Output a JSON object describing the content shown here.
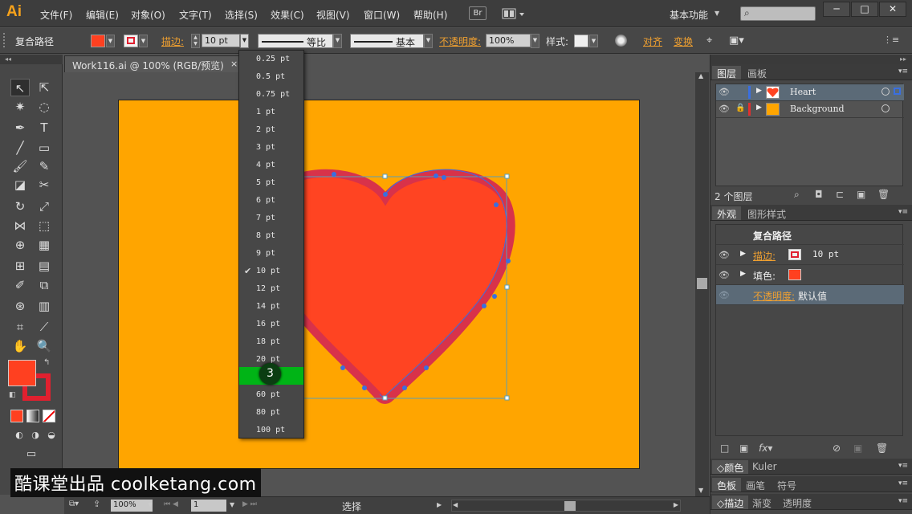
{
  "app": {
    "logo": "Ai",
    "workspace": "基本功能",
    "bridge_label": "Br"
  },
  "menu": [
    "文件(F)",
    "编辑(E)",
    "对象(O)",
    "文字(T)",
    "选择(S)",
    "效果(C)",
    "视图(V)",
    "窗口(W)",
    "帮助(H)"
  ],
  "window_controls": {
    "minimize": "─",
    "maximize": "□",
    "close": "✕"
  },
  "control_bar": {
    "object_type": "复合路径",
    "stroke_label": "描边:",
    "stroke_weight": "10 pt",
    "line_profile": "等比",
    "brush": "基本",
    "opacity_label": "不透明度:",
    "opacity_value": "100%",
    "style_label": "样式:",
    "align_label": "对齐",
    "transform_label": "变换",
    "fill_color": "#ff4020",
    "stroke_color": "#e02030"
  },
  "document": {
    "tab_title": "Work116.ai @ 100% (RGB/预览)",
    "close": "×"
  },
  "stroke_dropdown": {
    "items": [
      "0.25 pt",
      "0.5 pt",
      "0.75 pt",
      "1 pt",
      "2 pt",
      "3 pt",
      "4 pt",
      "5 pt",
      "6 pt",
      "7 pt",
      "8 pt",
      "9 pt",
      "10 pt",
      "12 pt",
      "14 pt",
      "16 pt",
      "18 pt",
      "20 pt",
      "",
      "60 pt",
      "80 pt",
      "100 pt"
    ],
    "checked": "10 pt",
    "highlight_color": "#00b416",
    "cursor_badge": "3"
  },
  "layers_panel": {
    "tabs": [
      "图层",
      "画板"
    ],
    "layers": [
      {
        "name": "Heart",
        "color": "#3a6fe0"
      },
      {
        "name": "Background",
        "color": "#e03030"
      }
    ],
    "count": "2 个图层"
  },
  "appearance_panel": {
    "tabs": [
      "外观",
      "图形样式"
    ],
    "title": "复合路径",
    "stroke_label": "描边:",
    "stroke_value": "10 pt",
    "fill_label": "填色:",
    "opacity_label": "不透明度:",
    "opacity_value": "默认值"
  },
  "bottom_panels": {
    "row1": [
      "颜色",
      "Kuler"
    ],
    "row2": [
      "色板",
      "画笔",
      "符号"
    ],
    "row3": [
      "描边",
      "渐变",
      "透明度"
    ]
  },
  "status_bar": {
    "zoom": "100%",
    "page": "1",
    "tool": "选择"
  },
  "watermark": "酷课堂出品 coolketang.com",
  "colors": {
    "artboard": "#ffa500",
    "heart_fill": "#ff4422",
    "heart_stroke": "#d8324a",
    "selection": "#3a78d8"
  }
}
